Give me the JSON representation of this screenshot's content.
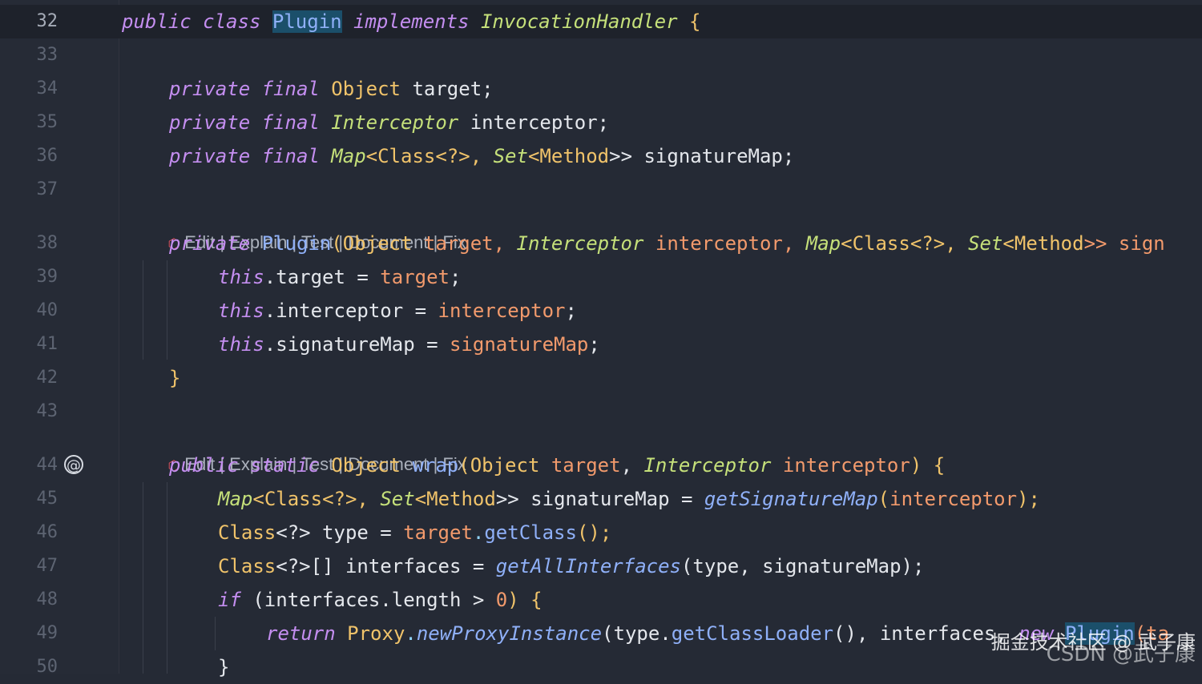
{
  "line_numbers": [
    "32",
    "33",
    "34",
    "35",
    "36",
    "37",
    "38",
    "39",
    "40",
    "41",
    "42",
    "43",
    "44",
    "45",
    "46",
    "47",
    "48",
    "49",
    "50"
  ],
  "code_lens": {
    "actions": [
      "Edit",
      "Explain",
      "Test",
      "Document",
      "Fix"
    ],
    "separator": " | "
  },
  "lines": {
    "l32": [
      "public class ",
      "Plugin",
      " implements ",
      "InvocationHandler",
      " {"
    ],
    "l34": [
      "private final ",
      "Object",
      " target;"
    ],
    "l35": [
      "private final ",
      "Interceptor",
      " interceptor;"
    ],
    "l36": [
      "private final ",
      "Map",
      "<",
      "Class",
      "<?>, ",
      "Set",
      "<",
      "Method",
      ">> signatureMap;"
    ],
    "l38": [
      "private ",
      "Plugin",
      "(",
      "Object",
      " target, ",
      "Interceptor",
      " interceptor, ",
      "Map",
      "<",
      "Class",
      "<?>, ",
      "Set",
      "<",
      "Method",
      ">> sign"
    ],
    "l39": [
      "this",
      ".target = ",
      "target",
      ";"
    ],
    "l40": [
      "this",
      ".interceptor = ",
      "interceptor",
      ";"
    ],
    "l41": [
      "this",
      ".signatureMap = ",
      "signatureMap",
      ";"
    ],
    "l42": [
      "}"
    ],
    "l44": [
      "public static ",
      "Object",
      " ",
      "wrap",
      "(",
      "Object",
      " ",
      "target",
      ", ",
      "Interceptor",
      " ",
      "interceptor",
      ") {"
    ],
    "l45": [
      "Map",
      "<",
      "Class",
      "<?>, ",
      "Set",
      "<",
      "Method",
      ">> signatureMap = ",
      "getSignatureMap",
      "(",
      "interceptor",
      ");"
    ],
    "l46": [
      "Class",
      "<?> type = ",
      "target",
      ".",
      "getClass",
      "();"
    ],
    "l47": [
      "Class",
      "<?>[] interfaces = ",
      "getAllInterfaces",
      "(type, signatureMap);"
    ],
    "l48": [
      "if",
      " (interfaces.length > ",
      "0",
      ") {"
    ],
    "l49": [
      "return ",
      "Proxy",
      ".",
      "newProxyInstance",
      "(type.",
      "getClassLoader",
      "(), interfaces, ",
      "new ",
      "Plugin",
      "(ta"
    ],
    "l50": [
      "}"
    ]
  },
  "gutter_icons": {
    "l44": "@"
  },
  "watermark": {
    "line1": "掘金技术社区 @ 武子康",
    "line2": "CSDN @武子康"
  }
}
